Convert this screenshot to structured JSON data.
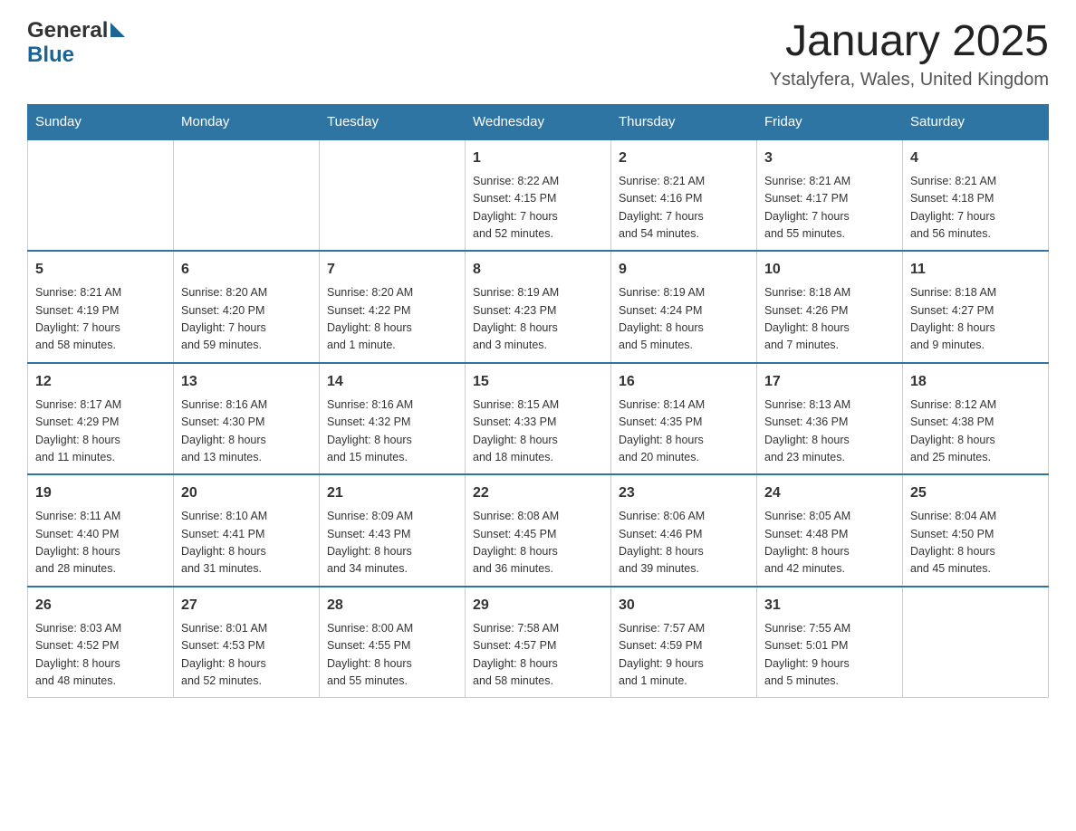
{
  "header": {
    "logo_text_general": "General",
    "logo_text_blue": "Blue",
    "month_title": "January 2025",
    "location": "Ystalyfera, Wales, United Kingdom"
  },
  "weekdays": [
    "Sunday",
    "Monday",
    "Tuesday",
    "Wednesday",
    "Thursday",
    "Friday",
    "Saturday"
  ],
  "weeks": [
    [
      {
        "day": "",
        "info": ""
      },
      {
        "day": "",
        "info": ""
      },
      {
        "day": "",
        "info": ""
      },
      {
        "day": "1",
        "info": "Sunrise: 8:22 AM\nSunset: 4:15 PM\nDaylight: 7 hours\nand 52 minutes."
      },
      {
        "day": "2",
        "info": "Sunrise: 8:21 AM\nSunset: 4:16 PM\nDaylight: 7 hours\nand 54 minutes."
      },
      {
        "day": "3",
        "info": "Sunrise: 8:21 AM\nSunset: 4:17 PM\nDaylight: 7 hours\nand 55 minutes."
      },
      {
        "day": "4",
        "info": "Sunrise: 8:21 AM\nSunset: 4:18 PM\nDaylight: 7 hours\nand 56 minutes."
      }
    ],
    [
      {
        "day": "5",
        "info": "Sunrise: 8:21 AM\nSunset: 4:19 PM\nDaylight: 7 hours\nand 58 minutes."
      },
      {
        "day": "6",
        "info": "Sunrise: 8:20 AM\nSunset: 4:20 PM\nDaylight: 7 hours\nand 59 minutes."
      },
      {
        "day": "7",
        "info": "Sunrise: 8:20 AM\nSunset: 4:22 PM\nDaylight: 8 hours\nand 1 minute."
      },
      {
        "day": "8",
        "info": "Sunrise: 8:19 AM\nSunset: 4:23 PM\nDaylight: 8 hours\nand 3 minutes."
      },
      {
        "day": "9",
        "info": "Sunrise: 8:19 AM\nSunset: 4:24 PM\nDaylight: 8 hours\nand 5 minutes."
      },
      {
        "day": "10",
        "info": "Sunrise: 8:18 AM\nSunset: 4:26 PM\nDaylight: 8 hours\nand 7 minutes."
      },
      {
        "day": "11",
        "info": "Sunrise: 8:18 AM\nSunset: 4:27 PM\nDaylight: 8 hours\nand 9 minutes."
      }
    ],
    [
      {
        "day": "12",
        "info": "Sunrise: 8:17 AM\nSunset: 4:29 PM\nDaylight: 8 hours\nand 11 minutes."
      },
      {
        "day": "13",
        "info": "Sunrise: 8:16 AM\nSunset: 4:30 PM\nDaylight: 8 hours\nand 13 minutes."
      },
      {
        "day": "14",
        "info": "Sunrise: 8:16 AM\nSunset: 4:32 PM\nDaylight: 8 hours\nand 15 minutes."
      },
      {
        "day": "15",
        "info": "Sunrise: 8:15 AM\nSunset: 4:33 PM\nDaylight: 8 hours\nand 18 minutes."
      },
      {
        "day": "16",
        "info": "Sunrise: 8:14 AM\nSunset: 4:35 PM\nDaylight: 8 hours\nand 20 minutes."
      },
      {
        "day": "17",
        "info": "Sunrise: 8:13 AM\nSunset: 4:36 PM\nDaylight: 8 hours\nand 23 minutes."
      },
      {
        "day": "18",
        "info": "Sunrise: 8:12 AM\nSunset: 4:38 PM\nDaylight: 8 hours\nand 25 minutes."
      }
    ],
    [
      {
        "day": "19",
        "info": "Sunrise: 8:11 AM\nSunset: 4:40 PM\nDaylight: 8 hours\nand 28 minutes."
      },
      {
        "day": "20",
        "info": "Sunrise: 8:10 AM\nSunset: 4:41 PM\nDaylight: 8 hours\nand 31 minutes."
      },
      {
        "day": "21",
        "info": "Sunrise: 8:09 AM\nSunset: 4:43 PM\nDaylight: 8 hours\nand 34 minutes."
      },
      {
        "day": "22",
        "info": "Sunrise: 8:08 AM\nSunset: 4:45 PM\nDaylight: 8 hours\nand 36 minutes."
      },
      {
        "day": "23",
        "info": "Sunrise: 8:06 AM\nSunset: 4:46 PM\nDaylight: 8 hours\nand 39 minutes."
      },
      {
        "day": "24",
        "info": "Sunrise: 8:05 AM\nSunset: 4:48 PM\nDaylight: 8 hours\nand 42 minutes."
      },
      {
        "day": "25",
        "info": "Sunrise: 8:04 AM\nSunset: 4:50 PM\nDaylight: 8 hours\nand 45 minutes."
      }
    ],
    [
      {
        "day": "26",
        "info": "Sunrise: 8:03 AM\nSunset: 4:52 PM\nDaylight: 8 hours\nand 48 minutes."
      },
      {
        "day": "27",
        "info": "Sunrise: 8:01 AM\nSunset: 4:53 PM\nDaylight: 8 hours\nand 52 minutes."
      },
      {
        "day": "28",
        "info": "Sunrise: 8:00 AM\nSunset: 4:55 PM\nDaylight: 8 hours\nand 55 minutes."
      },
      {
        "day": "29",
        "info": "Sunrise: 7:58 AM\nSunset: 4:57 PM\nDaylight: 8 hours\nand 58 minutes."
      },
      {
        "day": "30",
        "info": "Sunrise: 7:57 AM\nSunset: 4:59 PM\nDaylight: 9 hours\nand 1 minute."
      },
      {
        "day": "31",
        "info": "Sunrise: 7:55 AM\nSunset: 5:01 PM\nDaylight: 9 hours\nand 5 minutes."
      },
      {
        "day": "",
        "info": ""
      }
    ]
  ]
}
